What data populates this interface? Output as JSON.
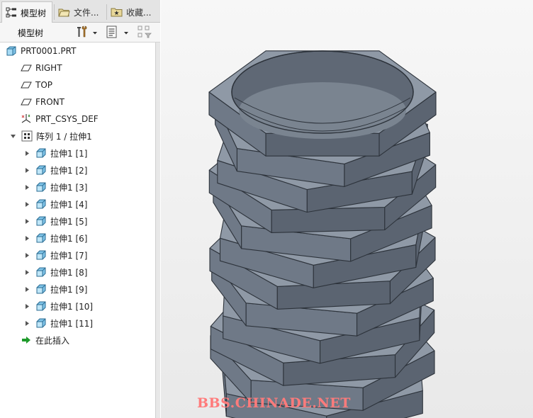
{
  "tabs": [
    {
      "label": "模型树",
      "icon": "model-tree-icon",
      "active": true
    },
    {
      "label": "文件...",
      "icon": "folder-browser-icon",
      "active": false
    },
    {
      "label": "收藏...",
      "icon": "favorites-icon",
      "active": false
    }
  ],
  "toolbar": {
    "title": "模型树",
    "settings_icon": "tools-icon",
    "show_icon": "list-settings-icon",
    "filter_icon": "tree-filter-icon"
  },
  "tree": {
    "root": {
      "label": "PRT0001.PRT",
      "icon": "part-icon"
    },
    "datums": [
      {
        "label": "RIGHT",
        "icon": "datum-plane-icon"
      },
      {
        "label": "TOP",
        "icon": "datum-plane-icon"
      },
      {
        "label": "FRONT",
        "icon": "datum-plane-icon"
      },
      {
        "label": "PRT_CSYS_DEF",
        "icon": "coordinate-system-icon"
      }
    ],
    "pattern": {
      "label": "阵列 1 / 拉伸1",
      "icon": "pattern-icon",
      "expanded": true
    },
    "pattern_items": [
      {
        "label": "拉伸1 [1]"
      },
      {
        "label": "拉伸1 [2]"
      },
      {
        "label": "拉伸1 [3]"
      },
      {
        "label": "拉伸1 [4]"
      },
      {
        "label": "拉伸1 [5]"
      },
      {
        "label": "拉伸1 [6]"
      },
      {
        "label": "拉伸1 [7]"
      },
      {
        "label": "拉伸1 [8]"
      },
      {
        "label": "拉伸1 [9]"
      },
      {
        "label": "拉伸1 [10]"
      },
      {
        "label": "拉伸1 [11]"
      }
    ],
    "insert": {
      "label": "在此插入",
      "icon": "insert-here-arrow-icon"
    }
  },
  "viewport": {
    "model": "twisted-hex-stack",
    "layer_count": 12,
    "colors": {
      "top": "#8f99a6",
      "left": "#6f7987",
      "right": "#5b6471",
      "edge": "#2d333b",
      "bore": "#5f6875"
    }
  },
  "watermark": "BBS.CHINADE.NET"
}
